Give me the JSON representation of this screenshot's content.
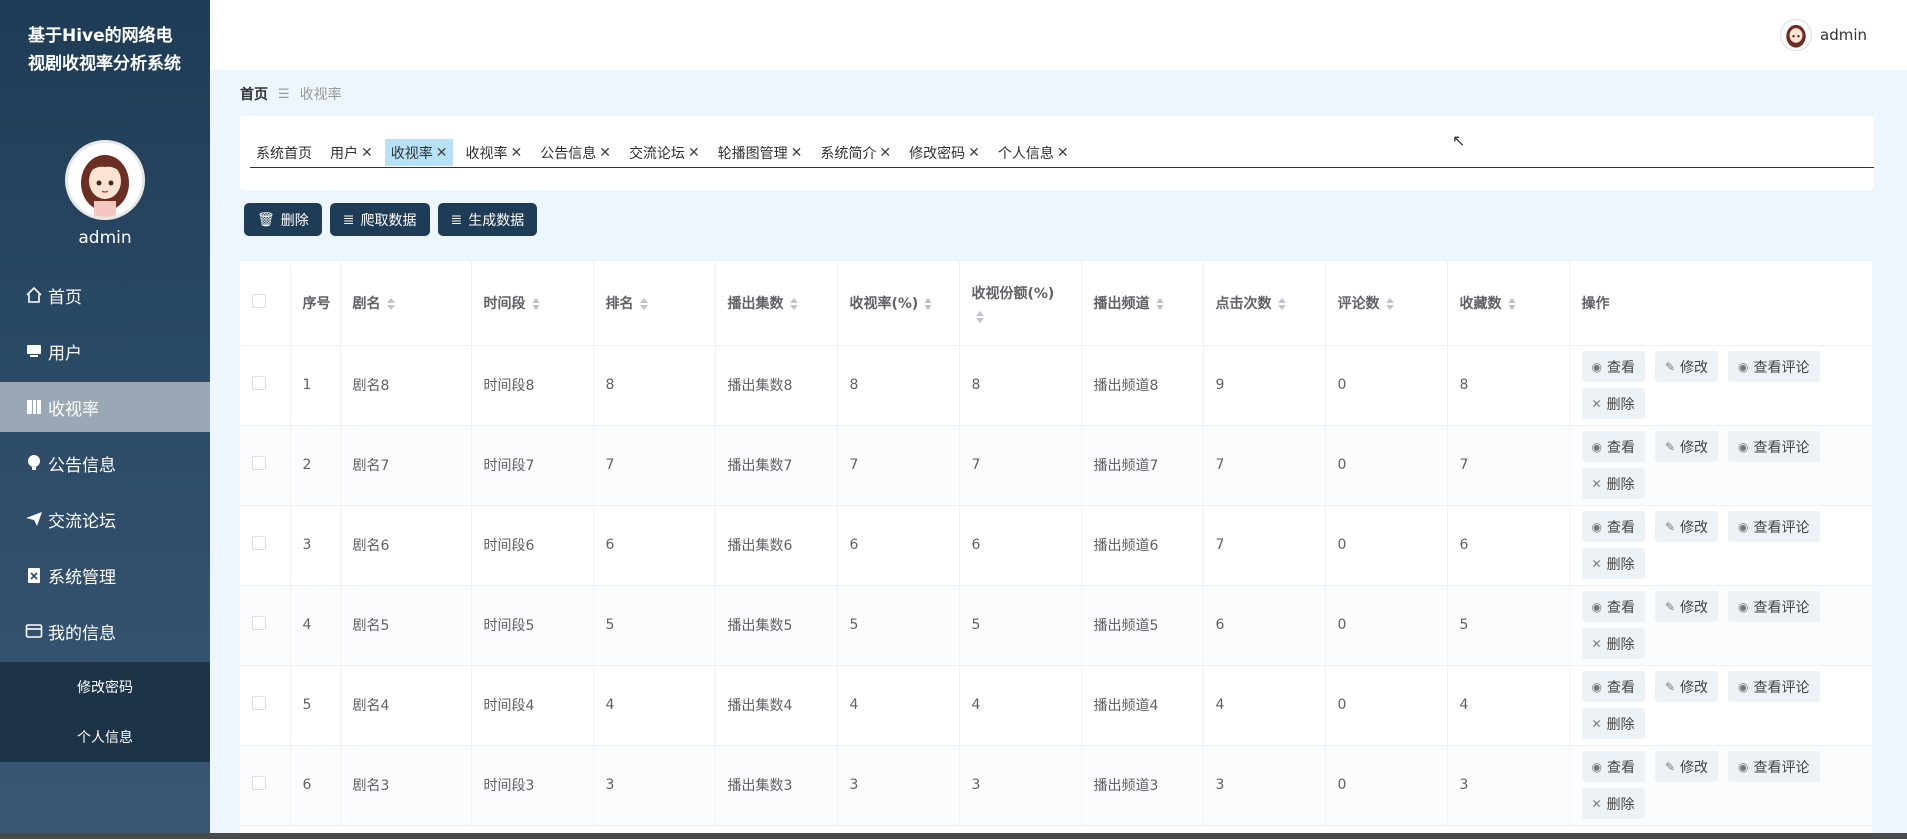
{
  "app": {
    "title": "基于Hive的网络电视剧收视率分析系统"
  },
  "user": {
    "name": "admin"
  },
  "sidebar": {
    "items": [
      {
        "label": "首页",
        "icon": "home-icon"
      },
      {
        "label": "用户",
        "icon": "user-icon"
      },
      {
        "label": "收视率",
        "icon": "book-icon",
        "active": true
      },
      {
        "label": "公告信息",
        "icon": "bulb-icon"
      },
      {
        "label": "交流论坛",
        "icon": "send-icon"
      },
      {
        "label": "系统管理",
        "icon": "clipboard-icon"
      },
      {
        "label": "我的信息",
        "icon": "card-icon"
      }
    ],
    "subitems": [
      {
        "label": "修改密码"
      },
      {
        "label": "个人信息"
      }
    ]
  },
  "breadcrumb": {
    "home": "首页",
    "current": "收视率"
  },
  "tags": [
    {
      "label": "系统首页",
      "closable": false
    },
    {
      "label": "用户",
      "closable": true
    },
    {
      "label": "收视率",
      "closable": true,
      "active": true
    },
    {
      "label": "收视率",
      "closable": true
    },
    {
      "label": "公告信息",
      "closable": true
    },
    {
      "label": "交流论坛",
      "closable": true
    },
    {
      "label": "轮播图管理",
      "closable": true
    },
    {
      "label": "系统简介",
      "closable": true
    },
    {
      "label": "修改密码",
      "closable": true
    },
    {
      "label": "个人信息",
      "closable": true
    }
  ],
  "toolbar": {
    "delete": "删除",
    "crawl": "爬取数据",
    "generate": "生成数据"
  },
  "table": {
    "headers": [
      "序号",
      "剧名",
      "时间段",
      "排名",
      "播出集数",
      "收视率(%)",
      "收视份额(%)",
      "播出频道",
      "点击次数",
      "评论数",
      "收藏数",
      "操作"
    ],
    "ops": {
      "view": "查看",
      "edit": "修改",
      "view_comments": "查看评论",
      "delete": "删除"
    },
    "rows": [
      [
        "1",
        "剧名8",
        "时间段8",
        "8",
        "播出集数8",
        "8",
        "8",
        "播出频道8",
        "9",
        "0",
        "8"
      ],
      [
        "2",
        "剧名7",
        "时间段7",
        "7",
        "播出集数7",
        "7",
        "7",
        "播出频道7",
        "7",
        "0",
        "7"
      ],
      [
        "3",
        "剧名6",
        "时间段6",
        "6",
        "播出集数6",
        "6",
        "6",
        "播出频道6",
        "7",
        "0",
        "6"
      ],
      [
        "4",
        "剧名5",
        "时间段5",
        "5",
        "播出集数5",
        "5",
        "5",
        "播出频道5",
        "6",
        "0",
        "5"
      ],
      [
        "5",
        "剧名4",
        "时间段4",
        "4",
        "播出集数4",
        "4",
        "4",
        "播出频道4",
        "4",
        "0",
        "4"
      ],
      [
        "6",
        "剧名3",
        "时间段3",
        "3",
        "播出集数3",
        "3",
        "3",
        "播出频道3",
        "3",
        "0",
        "3"
      ]
    ]
  }
}
